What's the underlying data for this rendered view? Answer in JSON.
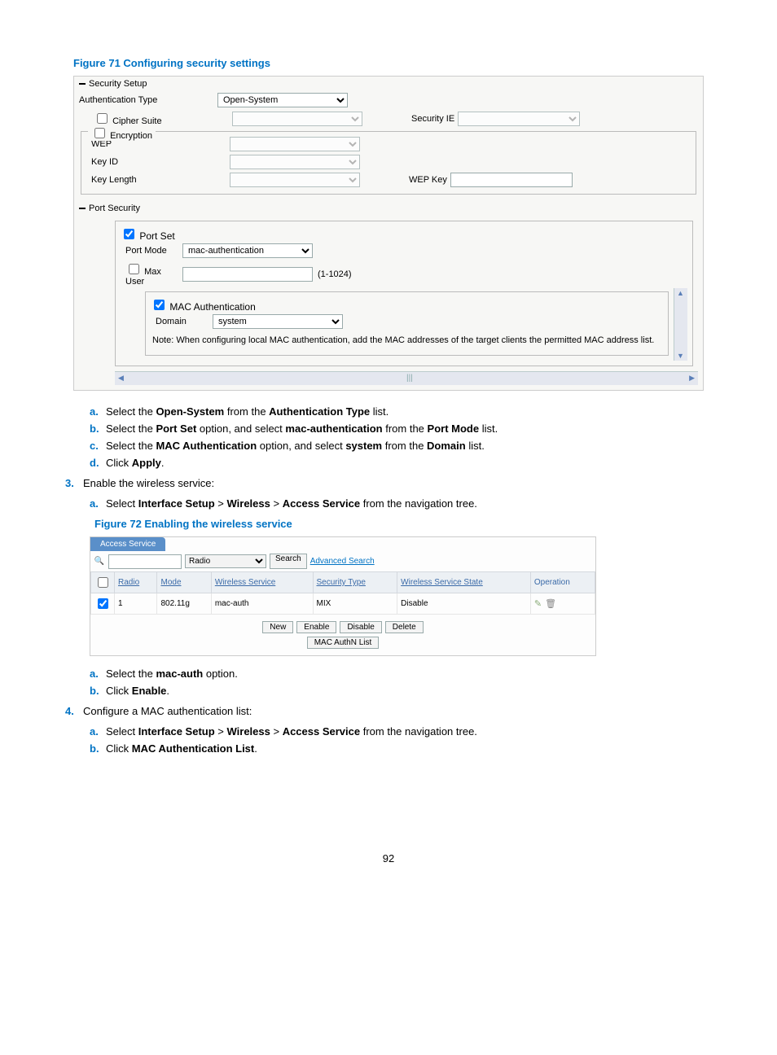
{
  "figure71": {
    "title": "Figure 71 Configuring security settings",
    "security_setup_label": "Security Setup",
    "auth_type_label": "Authentication Type",
    "auth_type_value": "Open-System",
    "cipher_suite_label": "Cipher Suite",
    "security_ie_label": "Security IE",
    "encryption_label": "Encryption",
    "wep_label": "WEP",
    "key_id_label": "Key ID",
    "key_length_label": "Key Length",
    "wep_key_label": "WEP Key",
    "port_security_label": "Port Security",
    "port_set_label": "Port Set",
    "port_mode_label": "Port Mode",
    "port_mode_value": "mac-authentication",
    "max_user_label": "Max User",
    "max_user_hint": "(1-1024)",
    "mac_auth_label": "MAC Authentication",
    "domain_label": "Domain",
    "domain_value": "system",
    "note": "Note: When configuring local MAC authentication, add the MAC addresses of the target clients the permitted MAC address list."
  },
  "steps1": {
    "a": {
      "mk": "a.",
      "p1": "Select the ",
      "b1": "Open-System",
      "p2": " from the ",
      "b2": "Authentication Type",
      "p3": " list."
    },
    "b": {
      "mk": "b.",
      "p1": "Select the ",
      "b1": "Port Set",
      "p2": " option, and select ",
      "b2": "mac-authentication",
      "p3": " from the ",
      "b3": "Port Mode",
      "p4": " list."
    },
    "c": {
      "mk": "c.",
      "p1": "Select the ",
      "b1": "MAC Authentication",
      "p2": " option, and select ",
      "b2": "system",
      "p3": " from the ",
      "b3": "Domain",
      "p4": " list."
    },
    "d": {
      "mk": "d.",
      "p1": "Click ",
      "b1": "Apply",
      "p2": "."
    }
  },
  "step3": {
    "mk": "3.",
    "text": "Enable the wireless service:"
  },
  "step3a": {
    "mk": "a.",
    "p1": "Select ",
    "b1": "Interface Setup",
    "gt1": " > ",
    "b2": "Wireless",
    "gt2": " > ",
    "b3": "Access Service",
    "p2": " from the navigation tree."
  },
  "figure72": {
    "title": "Figure 72 Enabling the wireless service",
    "tab": "Access Service",
    "search_field_value": "Radio",
    "search_btn": "Search",
    "adv_search": "Advanced Search",
    "headers": {
      "cb": "",
      "radio": "Radio",
      "mode": "Mode",
      "ws": "Wireless Service",
      "st": "Security Type",
      "wss": "Wireless Service State",
      "op": "Operation"
    },
    "row": {
      "radio": "1",
      "mode": "802.11g",
      "ws": "mac-auth",
      "st": "MIX",
      "wss": "Disable"
    },
    "btns": {
      "new": "New",
      "enable": "Enable",
      "disable": "Disable",
      "delete": "Delete",
      "maclist": "MAC AuthN List"
    }
  },
  "steps2": {
    "a": {
      "mk": "a.",
      "p1": "Select the ",
      "b1": "mac-auth",
      "p2": " option."
    },
    "b": {
      "mk": "b.",
      "p1": "Click ",
      "b1": "Enable",
      "p2": "."
    }
  },
  "step4": {
    "mk": "4.",
    "text": "Configure a MAC authentication list:"
  },
  "step4a": {
    "mk": "a.",
    "p1": "Select ",
    "b1": "Interface Setup",
    "gt1": " > ",
    "b2": "Wireless",
    "gt2": " > ",
    "b3": "Access Service",
    "p2": " from the navigation tree."
  },
  "step4b": {
    "mk": "b.",
    "p1": "Click ",
    "b1": "MAC Authentication List",
    "p2": "."
  },
  "page_num": "92"
}
